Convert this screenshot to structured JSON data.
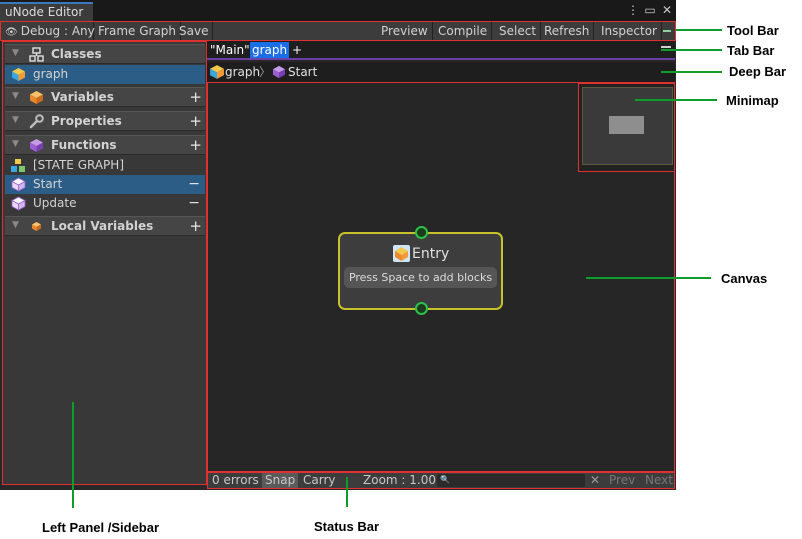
{
  "window": {
    "title": "uNode Editor",
    "controls": [
      "⋮",
      "▭",
      "✕"
    ]
  },
  "toolbar": {
    "debug_label": "Debug : Any",
    "frame_graph": "Frame Graph",
    "save": "Save",
    "preview": "Preview",
    "compile": "Compile",
    "select": "Select",
    "refresh": "Refresh",
    "inspector": "Inspector"
  },
  "sidebar": {
    "classes_label": "Classes",
    "class_item": "graph",
    "variables_label": "Variables",
    "properties_label": "Properties",
    "functions_label": "Functions",
    "functions": [
      "[STATE GRAPH]",
      "Start",
      "Update"
    ],
    "local_variables_label": "Local Variables",
    "plus": "+",
    "minus": "−"
  },
  "tabs": {
    "main": "\"Main\"",
    "graph": "graph",
    "add": "+"
  },
  "breadcrumb": {
    "root": "graph",
    "separator": "〉",
    "current": "Start"
  },
  "canvas": {
    "entry_title": "Entry",
    "entry_hint": "Press Space to add blocks"
  },
  "status_bar": {
    "errors": "0 errors",
    "snap": "Snap",
    "carry": "Carry",
    "zoom": "Zoom : 1.00",
    "search_icon": "🔍",
    "clear": "✕",
    "prev": "Prev",
    "next": "Next"
  },
  "annotations": {
    "tool_bar": "Tool Bar",
    "tab_bar": "Tab Bar",
    "deep_bar": "Deep Bar",
    "minimap": "Minimap",
    "canvas": "Canvas",
    "left_panel": "Left Panel /Sidebar",
    "status_bar": "Status Bar"
  },
  "colors": {
    "annotation_line": "#0f9d2a",
    "highlight_border": "#e03131",
    "selected_row": "#2c5d87",
    "active_tab": "#1a6ee6",
    "node_border": "#c9c12b",
    "port": "#2bc24a"
  }
}
